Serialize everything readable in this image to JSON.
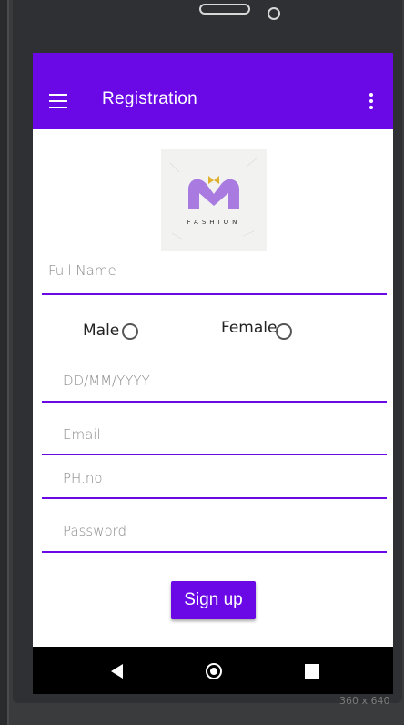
{
  "appbar": {
    "title": "Registration",
    "background": "#6a08e6"
  },
  "logo": {
    "text": "FASHION"
  },
  "form": {
    "full_name_placeholder": "Full Name",
    "gender": {
      "male_label": "Male",
      "female_label": "Female"
    },
    "dob_placeholder": "DD/MM/YYYY",
    "email_placeholder": "Email",
    "phone_placeholder": "PH.no",
    "password_placeholder": "Password",
    "signup_label": "Sign up"
  },
  "navbar": {
    "icons": [
      "back-icon",
      "home-icon",
      "recents-icon"
    ]
  },
  "emulator": {
    "resolution": "360 x 640"
  }
}
